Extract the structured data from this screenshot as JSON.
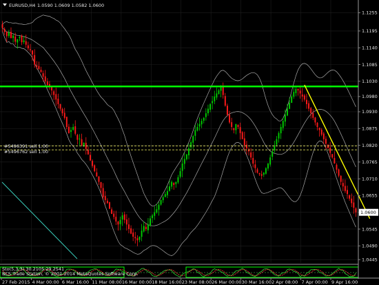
{
  "header": {
    "arrow_icon": "triangle-down-icon",
    "symbol": "EURUSD,H4",
    "ohlc": "1.0590 1.0609 1.0582 1.0600"
  },
  "order_labels": [
    "#5496391 sell 1.00",
    "#5496762 sell 1.00"
  ],
  "indicator": {
    "title": "Sto(5,3,3) 30.2105 29.2541",
    "copyright": "BCS Trade Station, © 2001-2014 MetaQuotes Software Corp.",
    "price_label": "1.0600"
  },
  "colors": {
    "background": "#000000",
    "bull": "#00cc00",
    "bear": "#ff1a1a",
    "grid": "#1f1f1f",
    "level_line": "#00ff00",
    "trendline": "#ffff00",
    "order_line": "#ffff66",
    "bands": "#c8c8c8",
    "cyan_line": "#3bd3c0"
  },
  "chart_data": {
    "type": "candlestick",
    "symbol": "EURUSD",
    "timeframe": "H4",
    "last_price": 1.06,
    "ylim": [
      1.0434,
      1.1265
    ],
    "y_ticks": [
      "1.1255",
      "1.1195",
      "1.1140",
      "1.1085",
      "1.1030",
      "1.0980",
      "1.0930",
      "1.0875",
      "1.0820",
      "1.0765",
      "1.0710",
      "1.0655",
      "1.0600",
      "1.0545",
      "1.0490",
      "1.0445"
    ],
    "x_ticks": [
      "27 Feb 2015",
      "4 Mar 00:00",
      "6 Mar 16:00",
      "11 Mar 08:00",
      "16 Mar 00:00",
      "18 Mar 16:00",
      "23 Mar 08:00",
      "26 Mar 00:00",
      "30 Mar 16:00",
      "2 Apr 08:00",
      "7 Apr 00:00",
      "9 Apr 16:00"
    ],
    "horizontal_levels": [
      1.1013
    ],
    "order_levels": [
      1.0818,
      1.0805
    ],
    "trendline": {
      "from": {
        "bar": 141,
        "price": 1.1018
      },
      "to": {
        "bar": 167,
        "price": 1.062
      }
    },
    "close": [
      1.1205,
      1.1192,
      1.1178,
      1.119,
      1.1172,
      1.118,
      1.116,
      1.1168,
      1.1176,
      1.1158,
      1.1164,
      1.115,
      1.1138,
      1.1132,
      1.1118,
      1.1085,
      1.1078,
      1.107,
      1.106,
      1.1045,
      1.103,
      1.1018,
      1.1012,
      1.1,
      1.0985,
      1.097,
      1.0955,
      1.094,
      1.0925,
      1.091,
      1.088,
      1.086,
      1.087,
      1.088,
      1.0858,
      1.0838,
      1.0842,
      1.082,
      1.0828,
      1.0808,
      1.079,
      1.077,
      1.0752,
      1.0735,
      1.0718,
      1.07,
      1.068,
      1.065,
      1.064,
      1.063,
      1.0612,
      1.0595,
      1.0585,
      1.057,
      1.056,
      1.0575,
      1.059,
      1.0575,
      1.056,
      1.0545,
      1.053,
      1.052,
      1.0515,
      1.0508,
      1.052,
      1.054,
      1.0555,
      1.0545,
      1.056,
      1.058,
      1.059,
      1.06,
      1.061,
      1.0625,
      1.064,
      1.065,
      1.066,
      1.067,
      1.0685,
      1.07,
      1.069,
      1.07,
      1.0715,
      1.0735,
      1.076,
      1.0775,
      1.079,
      1.081,
      1.083,
      1.085,
      1.087,
      1.088,
      1.089,
      1.09,
      1.091,
      1.0925,
      1.094,
      1.0955,
      1.0965,
      1.098,
      1.099,
      1.1,
      1.101,
      1.0985,
      1.095,
      1.092,
      1.0895,
      1.088,
      1.087,
      1.089,
      1.088,
      1.086,
      1.084,
      1.082,
      1.081,
      1.08,
      1.078,
      1.076,
      1.0745,
      1.073,
      1.0725,
      1.072,
      1.073,
      1.0745,
      1.076,
      1.078,
      1.08,
      1.082,
      1.084,
      1.086,
      1.088,
      1.09,
      1.092,
      1.094,
      1.096,
      1.098,
      1.0995,
      1.1005,
      1.1,
      1.099,
      1.098,
      1.097,
      1.0955,
      1.094,
      1.0925,
      1.091,
      1.0895,
      1.088,
      1.087,
      1.0855,
      1.084,
      1.0825,
      1.081,
      1.0795,
      1.078,
      1.076,
      1.074,
      1.072,
      1.07,
      1.0685,
      1.067,
      1.066,
      1.0645,
      1.063,
      1.0615,
      1.06
    ]
  }
}
